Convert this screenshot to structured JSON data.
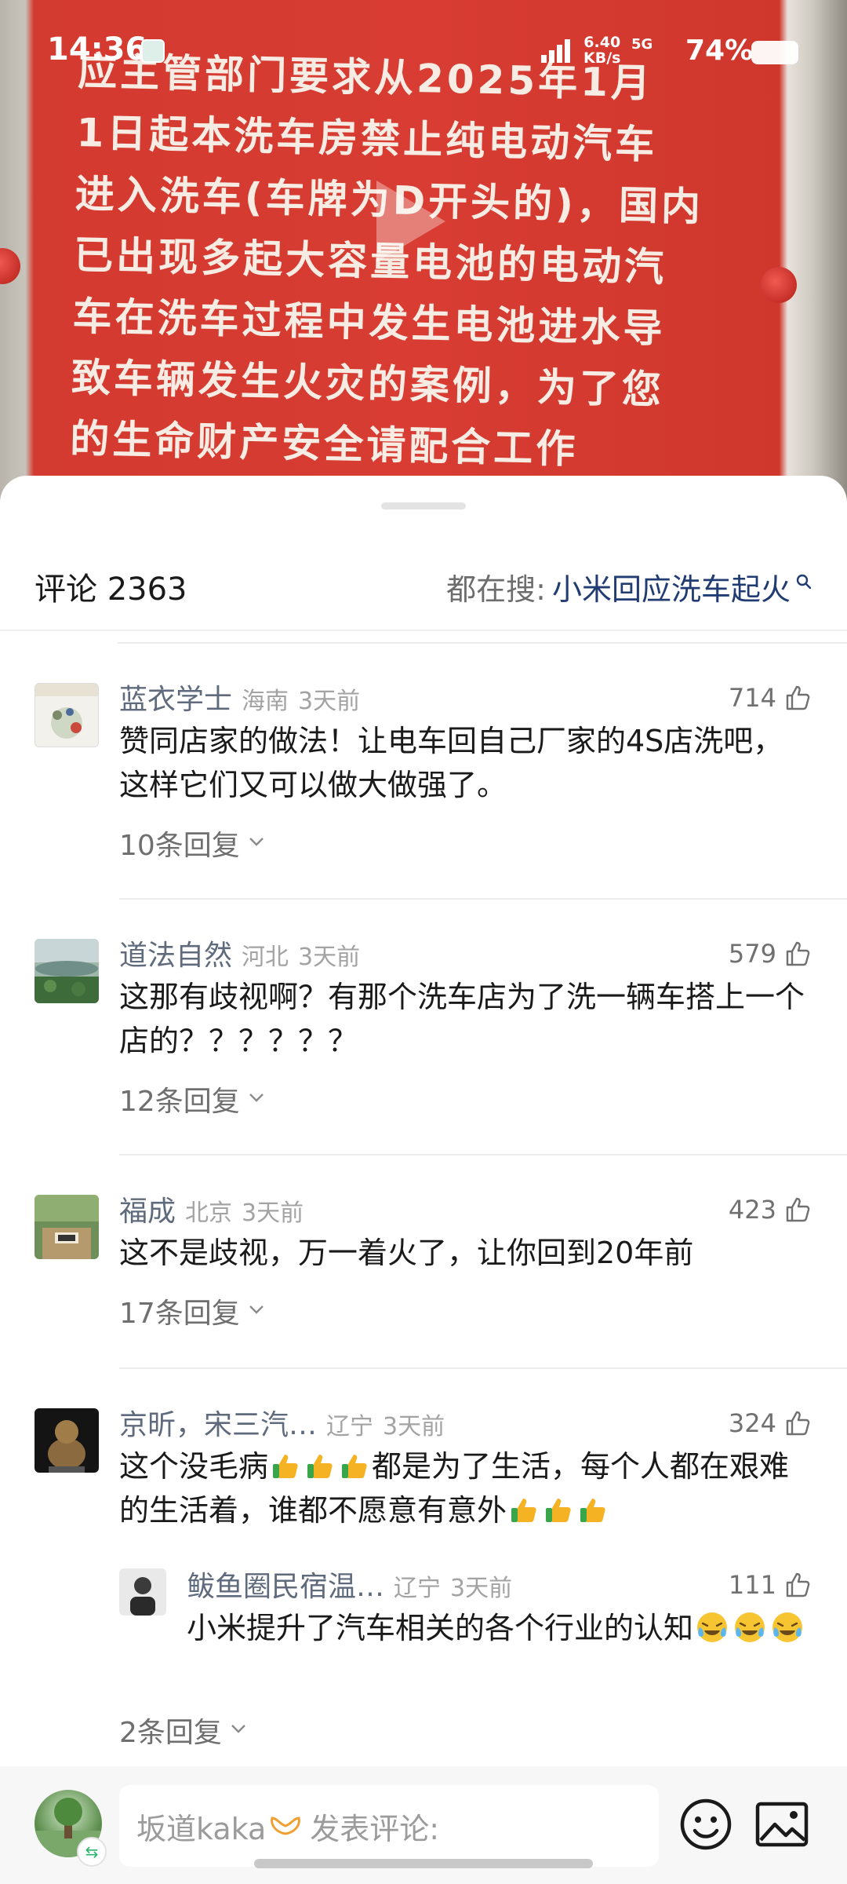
{
  "status_bar": {
    "time": "14:36",
    "net_speed_value": "6.40",
    "net_speed_unit": "KB/s",
    "network": "5G",
    "battery": "74%"
  },
  "video": {
    "poster_lines": [
      "应主管部门要求从2025年1月",
      "1日起本洗车房禁止纯电动汽车",
      "进入洗车(车牌为D开头的)，国内",
      "已出现多起大容量电池的电动汽",
      "车在洗车过程中发生电池进水导",
      "致车辆发生火灾的案例，为了您",
      "的生命财产安全请配合工作"
    ]
  },
  "header": {
    "title": "评论 2363",
    "search_label": "都在搜:",
    "search_term": "小米回应洗车起火"
  },
  "comments": [
    {
      "name": "蓝衣学士",
      "location": "海南",
      "time": "3天前",
      "likes": "714",
      "text": "赞同店家的做法！让电车回自己厂家的4S店洗吧，这样它们又可以做大做强了。",
      "replies": "10条回复"
    },
    {
      "name": "道法自然",
      "location": "河北",
      "time": "3天前",
      "likes": "579",
      "text": "这那有歧视啊？有那个洗车店为了洗一辆车搭上一个店的？？？？？？",
      "replies": "12条回复"
    },
    {
      "name": "福成",
      "location": "北京",
      "time": "3天前",
      "likes": "423",
      "text": "这不是歧视，万一着火了，让你回到20年前",
      "replies": "17条回复"
    },
    {
      "name": "京昕，宋三汽…",
      "location": "辽宁",
      "time": "3天前",
      "likes": "324",
      "text_part1": "这个没毛病",
      "text_part2": "都是为了生活，每个人都在艰难的生活着，谁都不愿意有意外",
      "replies": "2条回复",
      "subreply": {
        "name": "鲅鱼圈民宿温…",
        "location": "辽宁",
        "time": "3天前",
        "likes": "111",
        "text": "小米提升了汽车相关的各个行业的认知"
      }
    }
  ],
  "input_bar": {
    "username": "坂道kaka",
    "placeholder": "发表评论:",
    "badge": "⇆"
  },
  "icons": {
    "like": "thumbs-up-outline-icon",
    "search": "search-icon",
    "chevron": "chevron-down-icon",
    "emoji": "emoji-smile-icon",
    "image": "image-icon",
    "thumb_emoji": "thumbs-up-emoji-icon",
    "laugh_emoji": "laugh-cry-emoji-icon"
  },
  "colors": {
    "poster_red": "#d83c32",
    "search_term": "#203c72",
    "name": "#5f6a7c",
    "thumb_emoji": "#f5b323"
  }
}
